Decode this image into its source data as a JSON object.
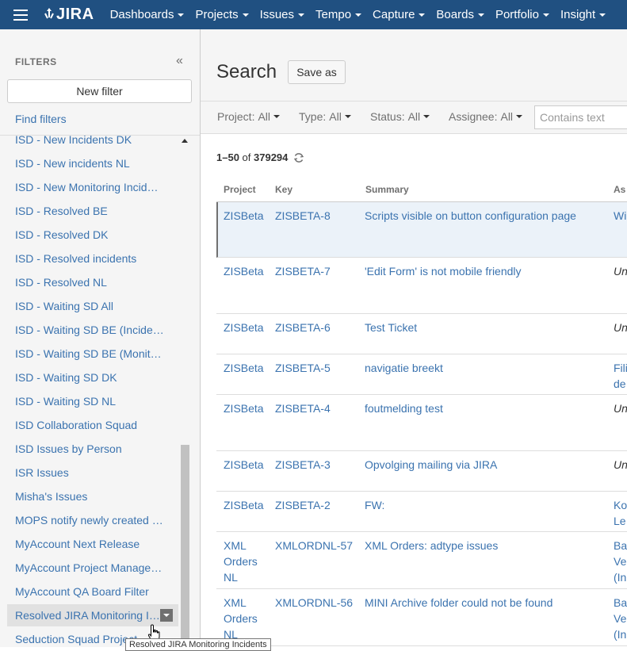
{
  "topnav": {
    "logo": "JIRA",
    "items": [
      "Dashboards",
      "Projects",
      "Issues",
      "Tempo",
      "Capture",
      "Boards",
      "Portfolio",
      "Insight"
    ]
  },
  "sidebar": {
    "header": "FILTERS",
    "new_filter": "New filter",
    "find_filters": "Find filters",
    "filters": [
      "ISD - New Incidents DK",
      "ISD - New incidents NL",
      "ISD - New Monitoring Incidents",
      "ISD - Resolved BE",
      "ISD - Resolved DK",
      "ISD - Resolved incidents",
      "ISD - Resolved NL",
      "ISD - Waiting SD All",
      "ISD - Waiting SD BE (Incidents)",
      "ISD - Waiting SD BE (Monitoring)",
      "ISD - Waiting SD DK",
      "ISD - Waiting SD NL",
      "ISD Collaboration Squad",
      "ISD Issues by Person",
      "ISR Issues",
      "Misha's Issues",
      "MOPS notify newly created issues",
      "MyAccount Next Release",
      "MyAccount Project Management",
      "MyAccount QA Board Filter",
      "Resolved JIRA Monitoring Incidents",
      "Seduction Squad Project"
    ],
    "tooltip": "Resolved JIRA Monitoring Incidents"
  },
  "main": {
    "title": "Search",
    "save_as": "Save as",
    "criteria": {
      "project_label": "Project:",
      "project_value": "All",
      "type_label": "Type:",
      "type_value": "All",
      "status_label": "Status:",
      "status_value": "All",
      "assignee_label": "Assignee:",
      "assignee_value": "All",
      "text_placeholder": "Contains text"
    },
    "count": {
      "range": "1–50",
      "of": "of",
      "total": "379294"
    },
    "columns": [
      "Project",
      "Key",
      "Summary",
      "As"
    ],
    "rows": [
      {
        "project": "ZISBeta",
        "key": "ZISBETA-8",
        "summary": "Scripts visible on button configuration page",
        "assignee": "Wi"
      },
      {
        "project": "ZISBeta",
        "key": "ZISBETA-7",
        "summary": "'Edit Form' is not mobile friendly",
        "assignee": "Un"
      },
      {
        "project": "ZISBeta",
        "key": "ZISBETA-6",
        "summary": "Test Ticket",
        "assignee": "Un"
      },
      {
        "project": "ZISBeta",
        "key": "ZISBETA-5",
        "summary": "navigatie breekt",
        "assignee": "Fili de"
      },
      {
        "project": "ZISBeta",
        "key": "ZISBETA-4",
        "summary": "foutmelding test",
        "assignee": "Un"
      },
      {
        "project": "ZISBeta",
        "key": "ZISBETA-3",
        "summary": "Opvolging mailing via JIRA",
        "assignee": "Un"
      },
      {
        "project": "ZISBeta",
        "key": "ZISBETA-2",
        "summary": "FW:",
        "assignee": "Ko Le"
      },
      {
        "project": "XML Orders NL",
        "key": "XMLORDNL-57",
        "summary": "XML Orders: adtype issues",
        "assignee": "Ba Ve (In"
      },
      {
        "project": "XML Orders NL",
        "key": "XMLORDNL-56",
        "summary": "MINI Archive folder could not be found",
        "assignee": "Ba Ve (In"
      }
    ]
  },
  "colors": {
    "nav_bg": "#205081",
    "link": "#3b73af",
    "selected_row": "#ebf2f9"
  }
}
